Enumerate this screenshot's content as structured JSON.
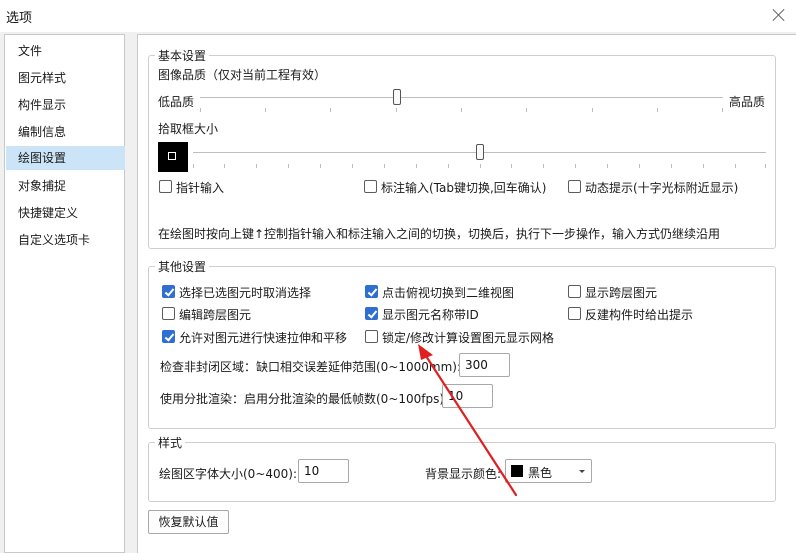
{
  "window": {
    "title": "选项"
  },
  "sidebar": {
    "items": [
      {
        "label": "文件"
      },
      {
        "label": "图元样式"
      },
      {
        "label": "构件显示"
      },
      {
        "label": "编制信息"
      },
      {
        "label": "绘图设置",
        "selected": true
      },
      {
        "label": "对象捕捉"
      },
      {
        "label": "快捷键定义"
      },
      {
        "label": "自定义选项卡"
      }
    ]
  },
  "basic": {
    "legend": "基本设置",
    "image_quality_label": "图像品质（仅对当前工程有效）",
    "low_label": "低品质",
    "high_label": "高品质",
    "pick_box_label": "拾取框大小",
    "pointer_input_label": "指针输入",
    "pointer_input_checked": false,
    "dim_input_label": "标注输入(Tab键切换,回车确认)",
    "dim_input_checked": false,
    "dyn_hint_label": "动态提示(十字光标附近显示)",
    "dyn_hint_checked": false,
    "note": "在绘图时按向上键↑控制指针输入和标注输入之间的切换，切换后，执行下一步操作，输入方式仍继续沿用"
  },
  "other": {
    "legend": "其他设置",
    "options": [
      {
        "label": "选择已选图元时取消选择",
        "checked": true
      },
      {
        "label": "点击俯视切换到二维视图",
        "checked": true
      },
      {
        "label": "显示跨层图元",
        "checked": false
      },
      {
        "label": "编辑跨层图元",
        "checked": false
      },
      {
        "label": "显示图元名称带ID",
        "checked": true
      },
      {
        "label": "反建构件时给出提示",
        "checked": false
      },
      {
        "label": "允许对图元进行快速拉伸和平移",
        "checked": true
      },
      {
        "label": "锁定/修改计算设置图元显示网格",
        "checked": false
      }
    ],
    "gap_label": "检查非封闭区域：缺口相交误差延伸范围(0~1000mm):",
    "gap_value": "300",
    "batch_label": "使用分批渲染：启用分批渲染的最低帧数(0~100fps):",
    "batch_value": "10"
  },
  "style": {
    "legend": "样式",
    "font_size_label": "绘图区字体大小(0~400):",
    "font_size_value": "10",
    "bg_color_label": "背景显示颜色:",
    "bg_color_value": "黑色",
    "bg_color_hex": "#000000"
  },
  "restore_button": "恢复默认值",
  "colors": {
    "accent": "#2f6fd1",
    "selection": "#cce4f7",
    "arrow": "#e02020"
  }
}
